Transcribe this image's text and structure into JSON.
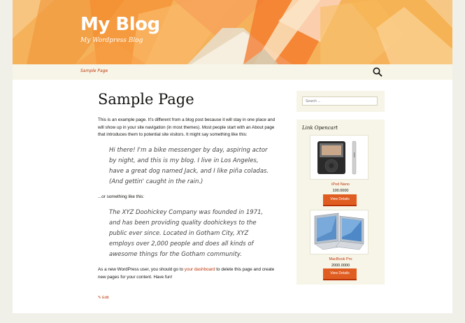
{
  "site": {
    "title": "My Blog",
    "description": "My Wordpress Blog"
  },
  "nav": {
    "items": [
      {
        "label": "Sample Page"
      }
    ]
  },
  "page": {
    "title": "Sample Page",
    "intro": "This is an example page. It's different from a blog post because it will stay in one place and will show up in your site navigation (in most themes). Most people start with an About page that introduces them to potential site visitors. It might say something like this:",
    "quote1": "Hi there! I'm a bike messenger by day, aspiring actor by night, and this is my blog. I live in Los Angeles, have a great dog named Jack, and I like piña coladas. (And gettin' caught in the rain.)",
    "or_text": "...or something like this:",
    "quote2": "The XYZ Doohickey Company was founded in 1971, and has been providing quality doohickeys to the public ever since. Located in Gotham City, XYZ employs over 2,000 people and does all kinds of awesome things for the Gotham community.",
    "outro_before": "As a new WordPress user, you should go to ",
    "outro_link": "your dashboard",
    "outro_after": " to delete this page and create new pages for your content. Have fun!",
    "edit_label": "Edit"
  },
  "sidebar": {
    "search_placeholder": "Search ...",
    "widget_title": "Link Opencart",
    "products": [
      {
        "name": "iPod Nano",
        "price": "100.0000",
        "button": "View Details"
      },
      {
        "name": "MacBook Pro",
        "price": "2000.0000",
        "button": "View Details"
      }
    ]
  },
  "colors": {
    "accent": "#bc360a",
    "button": "#e05d22",
    "header": "#f2a247",
    "nav_bg": "#f7f5e7"
  }
}
